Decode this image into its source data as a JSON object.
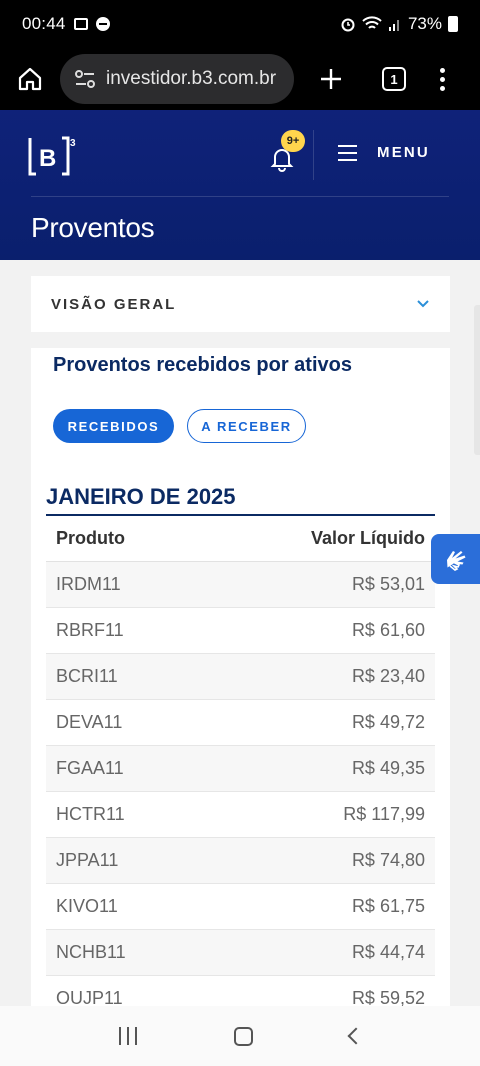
{
  "status_bar": {
    "time": "00:44",
    "battery": "73%"
  },
  "browser": {
    "url": "investidor.b3.com.br",
    "tab_count": "1"
  },
  "header": {
    "logo": "[B]³",
    "notification_badge": "9+",
    "menu_label": "MENU",
    "page_title": "Proventos"
  },
  "overview": {
    "label": "VISÃO GERAL"
  },
  "card": {
    "heading": "Proventos recebidos por ativos",
    "tabs": [
      {
        "label": "RECEBIDOS",
        "active": true
      },
      {
        "label": "A RECEBER",
        "active": false
      }
    ],
    "month": "JANEIRO DE 2025",
    "columns": {
      "product": "Produto",
      "value": "Valor Líquido"
    },
    "rows": [
      {
        "product": "IRDM11",
        "value": "R$ 53,01"
      },
      {
        "product": "RBRF11",
        "value": "R$ 61,60"
      },
      {
        "product": "BCRI11",
        "value": "R$ 23,40"
      },
      {
        "product": "DEVA11",
        "value": "R$ 49,72"
      },
      {
        "product": "FGAA11",
        "value": "R$ 49,35"
      },
      {
        "product": "HCTR11",
        "value": "R$ 117,99"
      },
      {
        "product": "JPPA11",
        "value": "R$ 74,80"
      },
      {
        "product": "KIVO11",
        "value": "R$ 61,75"
      },
      {
        "product": "NCHB11",
        "value": "R$ 44,74"
      },
      {
        "product": "OUJP11",
        "value": "R$ 59,52"
      }
    ]
  },
  "colors": {
    "header_bg": "#0f2279",
    "accent_blue": "#1766d6",
    "title_navy": "#0b2a63",
    "badge_yellow": "#ffd54d"
  }
}
